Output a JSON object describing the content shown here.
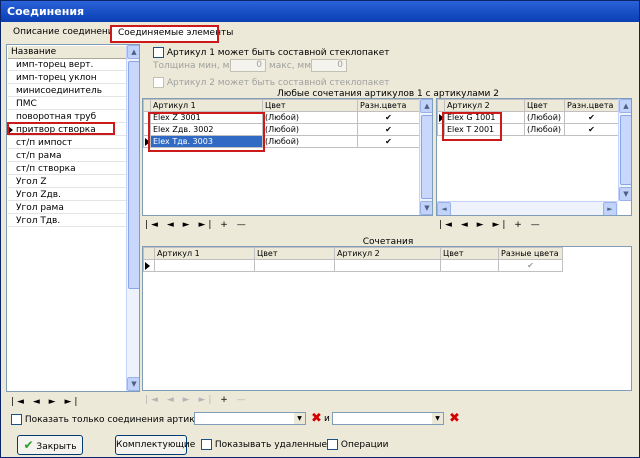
{
  "window": {
    "title": "Соединения"
  },
  "tabs": [
    "Описание соединений",
    "Соединяемые элементы"
  ],
  "left_list": {
    "header": "Название",
    "items": [
      "имп-торец верт.",
      "имп-торец уклон",
      "минисоединитель",
      "ПМС",
      "поворотная труб",
      "притвор створка",
      "ст/п импост",
      "ст/п рама",
      "ст/п створка",
      "Угол Z",
      "Угол Zдв.",
      "Угол рама",
      "Угол Тдв."
    ],
    "selected_index": 5
  },
  "options": {
    "art1_composite": "Артикул 1 может быть составной стеклопакет",
    "thickness_min_label": "Толщина мин, мм",
    "thickness_min": "0",
    "thickness_max_label": "макс, мм",
    "thickness_max": "0",
    "art2_composite": "Артикул 2 может быть составной стеклопакет"
  },
  "any_combo_caption": "Любые сочетания артикулов 1 с артикулами 2",
  "art1_table": {
    "columns": [
      "Артикул 1",
      "Цвет",
      "Разн.цвета"
    ],
    "rows": [
      {
        "article": "Elex Z 3001",
        "color": "(Любой)",
        "diff": "✔"
      },
      {
        "article": "Elex Zдв. 3002",
        "color": "(Любой)",
        "diff": "✔"
      },
      {
        "article": "Elex Тдв. 3003",
        "color": "(Любой)",
        "diff": "✔"
      }
    ],
    "selected_row": 2
  },
  "art2_table": {
    "columns": [
      "Артикул 2",
      "Цвет",
      "Разн.цвета"
    ],
    "rows": [
      {
        "article": "Elex G 1001",
        "color": "(Любой)",
        "diff": "✔"
      },
      {
        "article": "Elex T 2001",
        "color": "(Любой)",
        "diff": "✔"
      }
    ]
  },
  "combos": {
    "caption": "Сочетания",
    "columns": [
      "Артикул 1",
      "Цвет",
      "Артикул 2",
      "Цвет",
      "Разные цвета"
    ]
  },
  "nav": {
    "first": "|◄",
    "prev": "◄",
    "next": "►",
    "last": "►|",
    "add": "+",
    "del": "—"
  },
  "filter": {
    "show_only_label": "Показать только соединения артикулов",
    "and_label": "и"
  },
  "footer": {
    "close_label": "Закрыть",
    "complectations_label": "Комплектующие",
    "show_deleted_label": "Показывать удаленные",
    "operations_label": "Операции"
  },
  "colors": {
    "title_bar": "#0a3fb4",
    "selection": "#316ac5",
    "highlight_box": "#cc1a1a"
  }
}
